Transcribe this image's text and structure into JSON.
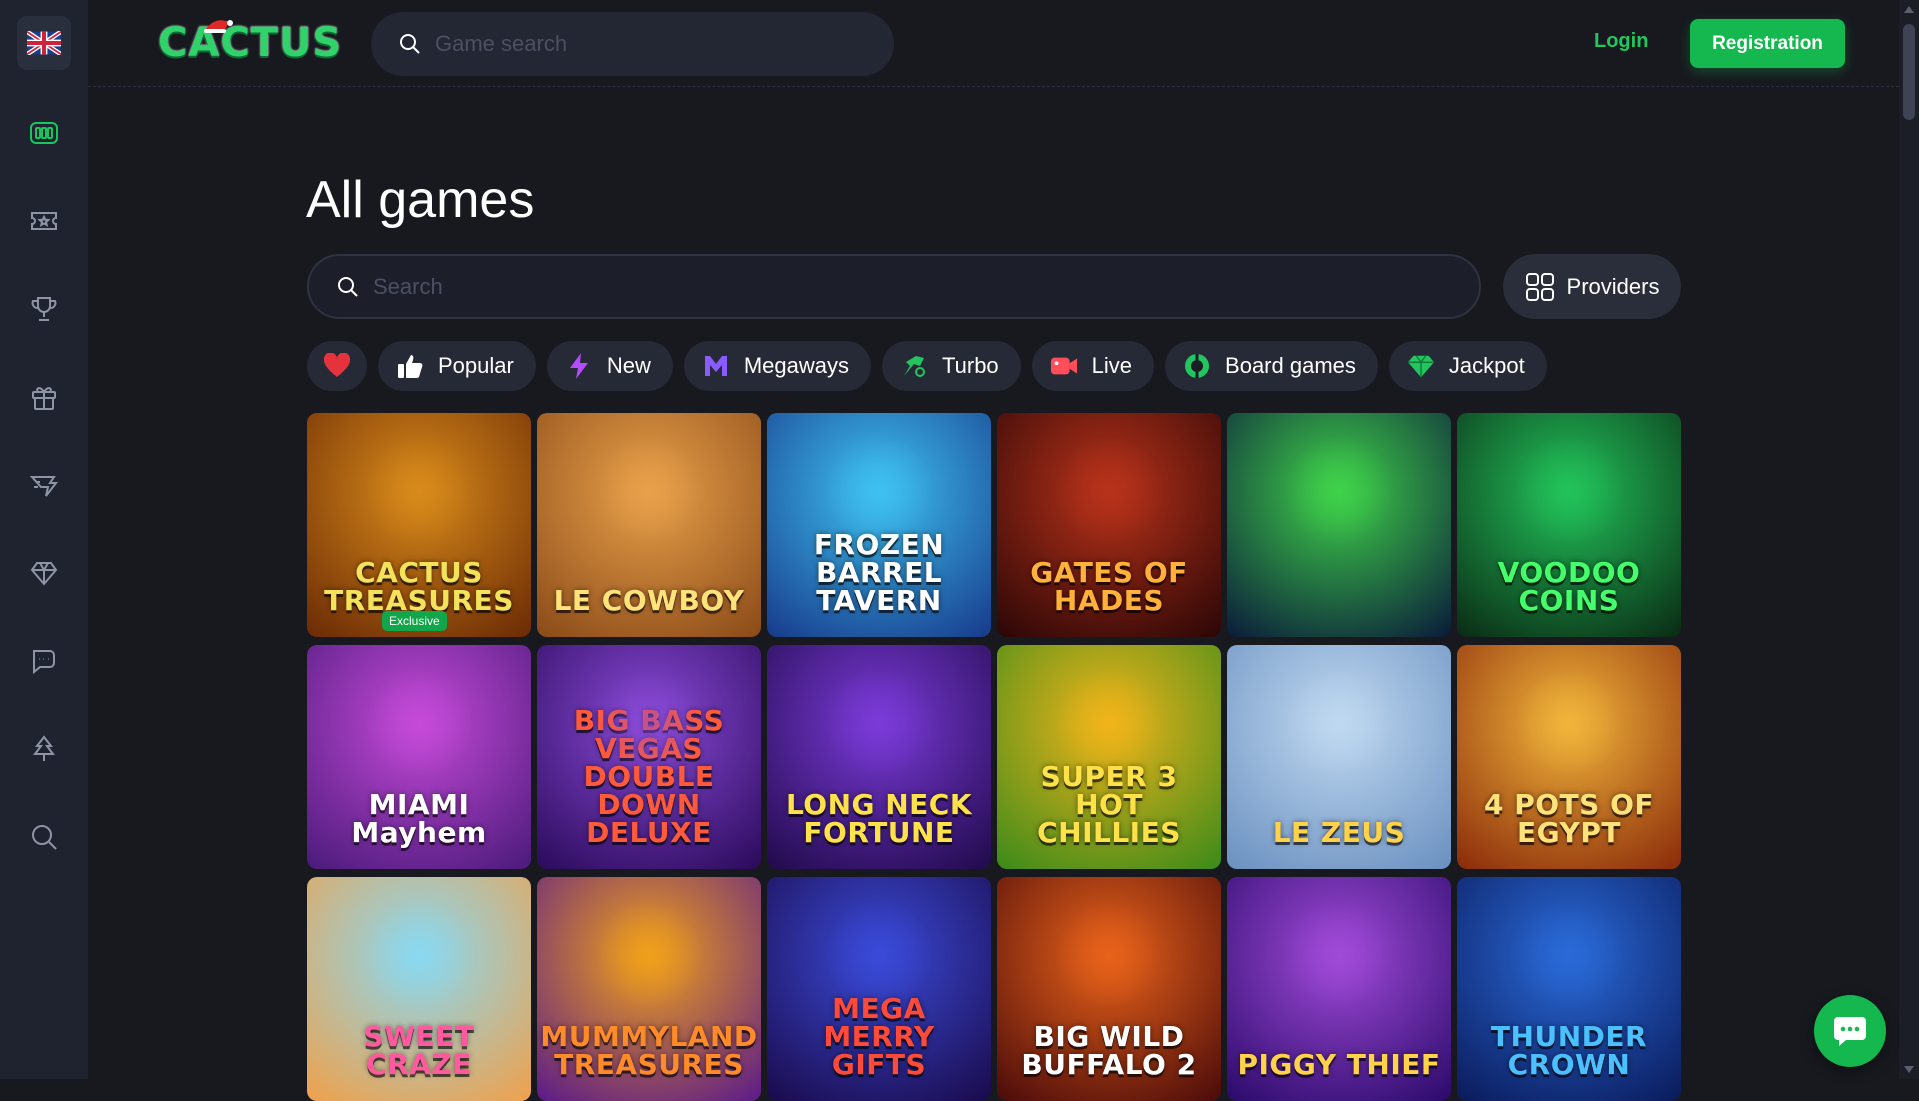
{
  "header": {
    "logo_text": "CACTUS",
    "search_placeholder": "Game search",
    "login_label": "Login",
    "registration_label": "Registration"
  },
  "sidebar": {
    "language_flag": "uk-flag-icon",
    "items": [
      {
        "icon": "slot-machine-icon",
        "active": true
      },
      {
        "icon": "ticket-icon",
        "active": false
      },
      {
        "icon": "trophy-icon",
        "active": false
      },
      {
        "icon": "gift-icon",
        "active": false
      },
      {
        "icon": "sports-icon",
        "active": false
      },
      {
        "icon": "diamond-icon",
        "active": false
      },
      {
        "icon": "chat-icon",
        "active": false
      },
      {
        "icon": "tree-icon",
        "active": false
      },
      {
        "icon": "search-icon",
        "active": false
      }
    ]
  },
  "main": {
    "title": "All games",
    "search_placeholder": "Search",
    "providers_label": "Providers",
    "categories": [
      {
        "label": "",
        "icon": "heart-icon",
        "color": "#e5333d"
      },
      {
        "label": "Popular",
        "icon": "thumbs-up-icon",
        "color": "#ffffff"
      },
      {
        "label": "New",
        "icon": "lightning-icon",
        "color": "#b34bff"
      },
      {
        "label": "Megaways",
        "icon": "megaways-icon",
        "color": "#8a5cff"
      },
      {
        "label": "Turbo",
        "icon": "turbo-icon",
        "color": "#22c55e"
      },
      {
        "label": "Live",
        "icon": "live-camera-icon",
        "color": "#ff4d5a"
      },
      {
        "label": "Board games",
        "icon": "board-games-icon",
        "color": "#22c55e"
      },
      {
        "label": "Jackpot",
        "icon": "jackpot-gem-icon",
        "color": "#22c55e"
      }
    ],
    "games": [
      {
        "title": "CACTUS TREASURES",
        "badge": "Exclusive",
        "bg1": "#d88a1a",
        "bg2": "#6a2a05",
        "text": "#f4e35a"
      },
      {
        "title": "LE COWBOY",
        "badge": "",
        "bg1": "#e8a04a",
        "bg2": "#8a4a18",
        "text": "#ffe27a"
      },
      {
        "title": "FROZEN BARREL TAVERN",
        "badge": "",
        "bg1": "#3ec1f0",
        "bg2": "#173a8a",
        "text": "#ffffff"
      },
      {
        "title": "GATES OF HADES",
        "badge": "",
        "bg1": "#b8321a",
        "bg2": "#2a0606",
        "text": "#ffb13a"
      },
      {
        "title": "",
        "badge": "",
        "bg1": "#3fd24a",
        "bg2": "#0a1a3a",
        "text": "#ffffff"
      },
      {
        "title": "VOODOO COINS",
        "badge": "",
        "bg1": "#22c25a",
        "bg2": "#0a2a14",
        "text": "#45ff6a"
      },
      {
        "title": "MIAMI Mayhem",
        "badge": "",
        "bg1": "#c54ad8",
        "bg2": "#4a1a7a",
        "text": "#ffffff"
      },
      {
        "title": "BIG BASS VEGAS DOUBLE DOWN DELUXE",
        "badge": "",
        "bg1": "#8a4ad8",
        "bg2": "#2a0a5a",
        "text": "#ff5a3a"
      },
      {
        "title": "LONG NECK FORTUNE",
        "badge": "",
        "bg1": "#7a3ad8",
        "bg2": "#200a4a",
        "text": "#ffe24a"
      },
      {
        "title": "SUPER 3 HOT CHILLIES",
        "badge": "",
        "bg1": "#f0b41a",
        "bg2": "#3a8a1a",
        "text": "#ffe24a"
      },
      {
        "title": "LE ZEUS",
        "badge": "",
        "bg1": "#bfd8f0",
        "bg2": "#6a90c0",
        "text": "#ffd24a"
      },
      {
        "title": "4 POTS OF EGYPT",
        "badge": "",
        "bg1": "#f0b43a",
        "bg2": "#8a2a0a",
        "text": "#ffe27a"
      },
      {
        "title": "SWEET CRAZE",
        "badge": "",
        "bg1": "#8ad8f0",
        "bg2": "#f0a04a",
        "text": "#ff5aa0"
      },
      {
        "title": "MUMMYLAND TREASURES",
        "badge": "",
        "bg1": "#f0a01a",
        "bg2": "#5a1a8a",
        "text": "#ff8a2a"
      },
      {
        "title": "MEGA MERRY GIFTS",
        "badge": "",
        "bg1": "#3a4ad8",
        "bg2": "#1a0a4a",
        "text": "#ff4a3a"
      },
      {
        "title": "BIG WILD BUFFALO 2",
        "badge": "",
        "bg1": "#e8621a",
        "bg2": "#4a0a0a",
        "text": "#ffffff"
      },
      {
        "title": "PIGGY THIEF",
        "badge": "",
        "bg1": "#a04ad8",
        "bg2": "#2a0a6a",
        "text": "#ffd24a"
      },
      {
        "title": "THUNDER CROWN",
        "badge": "",
        "bg1": "#2a6ad8",
        "bg2": "#0a1a5a",
        "text": "#4ac0ff"
      }
    ]
  },
  "chat": {
    "icon": "chat-bubble-icon"
  }
}
